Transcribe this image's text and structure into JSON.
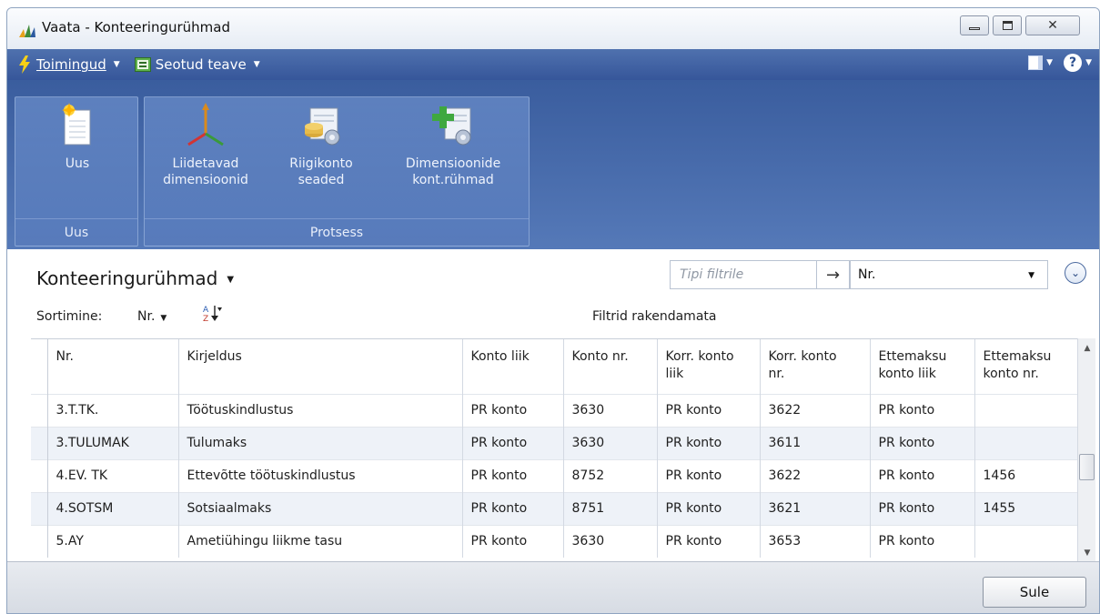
{
  "window": {
    "title": "Vaata - Konteeringurühmad"
  },
  "cmdbar": {
    "actions_label": "Toimingud",
    "related_label": "Seotud teave"
  },
  "ribbon": {
    "groups": [
      {
        "label": "Uus",
        "buttons": [
          {
            "label_line1": "Uus",
            "label_line2": "",
            "icon": "new-document-icon"
          }
        ]
      },
      {
        "label": "Protsess",
        "buttons": [
          {
            "label_line1": "Liidetavad",
            "label_line2": "dimensioonid",
            "icon": "dimensions-axes-icon"
          },
          {
            "label_line1": "Riigikonto",
            "label_line2": "seaded",
            "icon": "coins-setup-icon"
          },
          {
            "label_line1": "Dimensioonide",
            "label_line2": "kont.rühmad",
            "icon": "add-dimension-group-icon"
          }
        ]
      }
    ]
  },
  "page": {
    "title": "Konteeringurühmad",
    "filter_placeholder": "Tipi filtrile",
    "filter_field": "Nr.",
    "sort_label": "Sortimine:",
    "sort_field": "Nr.",
    "filters_status": "Filtrid rakendamata"
  },
  "table": {
    "headers": [
      [
        "Nr.",
        ""
      ],
      [
        "Kirjeldus",
        ""
      ],
      [
        "Konto liik",
        ""
      ],
      [
        "Konto nr.",
        ""
      ],
      [
        "Korr. konto",
        "liik"
      ],
      [
        "Korr. konto",
        "nr."
      ],
      [
        "Ettemaksu",
        "konto liik"
      ],
      [
        "Ettemaksu",
        "konto nr."
      ]
    ],
    "rows": [
      [
        "3.T.TK.",
        "Töötuskindlustus",
        "PR konto",
        "3630",
        "PR konto",
        "3622",
        "PR konto",
        ""
      ],
      [
        "3.TULUMAK",
        "Tulumaks",
        "PR konto",
        "3630",
        "PR konto",
        "3611",
        "PR konto",
        ""
      ],
      [
        "4.EV. TK",
        "Ettevõtte töötuskindlustus",
        "PR konto",
        "8752",
        "PR konto",
        "3622",
        "PR konto",
        "1456"
      ],
      [
        "4.SOTSM",
        "Sotsiaalmaks",
        "PR konto",
        "8751",
        "PR konto",
        "3621",
        "PR konto",
        "1455"
      ],
      [
        "5.AY",
        "Ametiühingu liikme tasu",
        "PR konto",
        "3630",
        "PR konto",
        "3653",
        "PR konto",
        ""
      ]
    ]
  },
  "footer": {
    "close_label": "Sule"
  },
  "colors": {
    "ribbon": "#4468a9",
    "cmdbar": "#3f60a3",
    "row_alt": "#eef2f8"
  }
}
